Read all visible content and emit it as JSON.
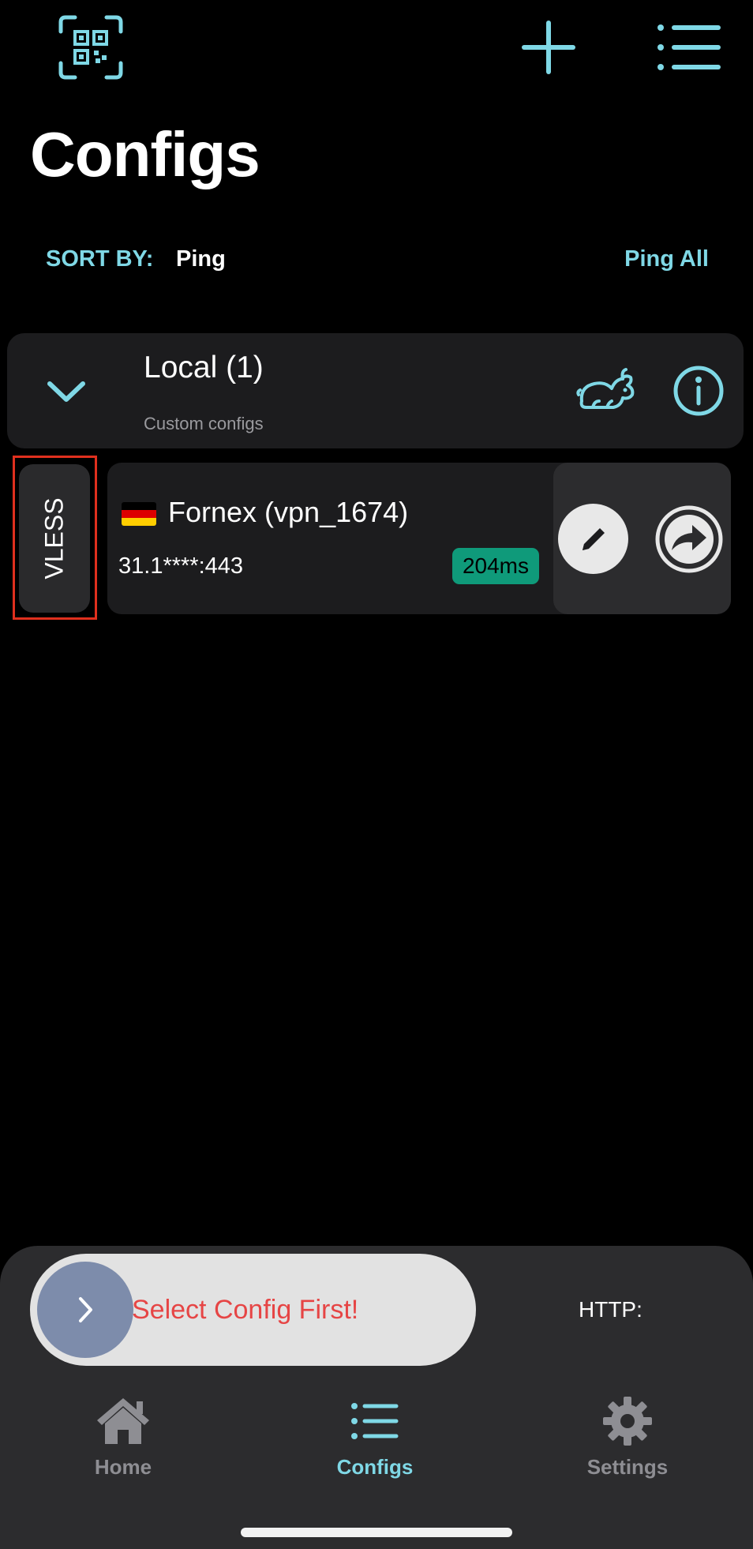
{
  "colors": {
    "accent": "#7fd8e6",
    "background": "#000000",
    "card": "#1c1c1e",
    "ping_good": "#0f9a7a",
    "error_text": "#e64545",
    "highlight_box": "#e0301e"
  },
  "header": {
    "icons": [
      "qr-scan-icon",
      "plus-icon",
      "menu-list-icon"
    ],
    "title": "Configs"
  },
  "sort": {
    "label": "SORT BY:",
    "value": "Ping",
    "ping_all": "Ping All"
  },
  "group": {
    "title": "Local (1)",
    "subtitle": "Custom configs",
    "icons": [
      "chevron-down-icon",
      "rabbit-icon",
      "info-icon"
    ]
  },
  "config": {
    "type": "VLESS",
    "flag": "germany-flag-icon",
    "name": "Fornex (vpn_1674)",
    "address": "31.1****:443",
    "ping": "204ms",
    "icons": [
      "pencil-icon",
      "share-arrow-icon"
    ]
  },
  "connect": {
    "status": "Select Config First!",
    "http_label": "HTTP:"
  },
  "tabs": [
    {
      "label": "Home",
      "icon": "house-icon",
      "active": false
    },
    {
      "label": "Configs",
      "icon": "list-icon",
      "active": true
    },
    {
      "label": "Settings",
      "icon": "gear-icon",
      "active": false
    }
  ]
}
